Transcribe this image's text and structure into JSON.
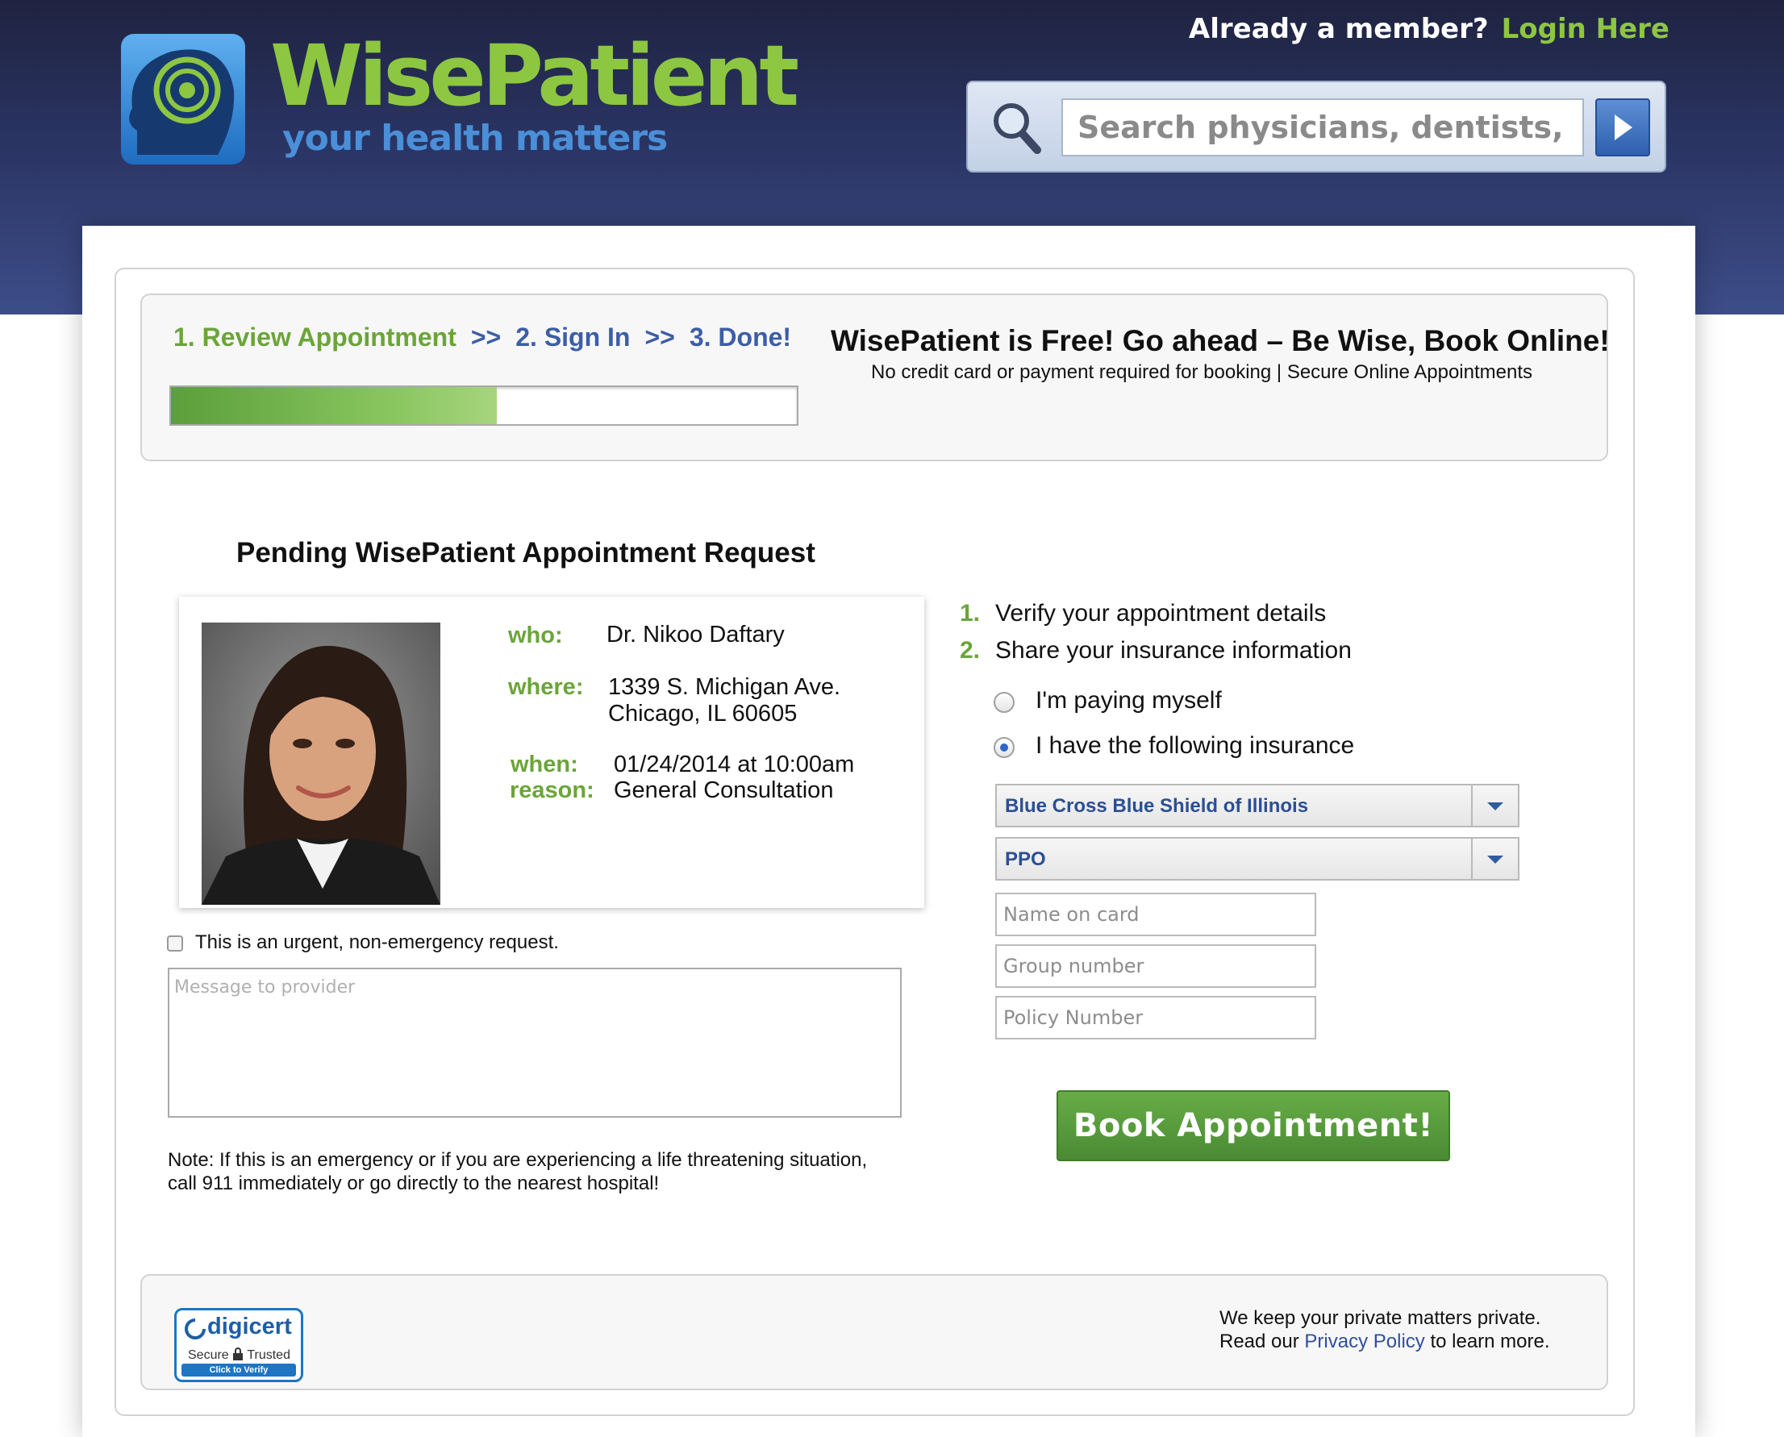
{
  "header": {
    "brand_name": "WisePatient",
    "tagline": "your health matters",
    "member_prompt": "Already a member?",
    "login_label": "Login Here",
    "search": {
      "placeholder": "Search physicians, dentists, etc"
    }
  },
  "progress": {
    "steps": [
      "1. Review Appointment",
      "2. Sign In",
      "3. Done!"
    ],
    "separator": ">>",
    "fraction_complete": 0.52,
    "colors": {
      "active": "#6aa539",
      "inactive": "#3c5ea8"
    }
  },
  "promo": {
    "title": "WisePatient is Free! Go ahead – Be Wise, Book Online!",
    "subtitle": "No credit card or payment required for booking | Secure Online Appointments"
  },
  "appointment": {
    "title": "Pending WisePatient Appointment Request",
    "who_label": "who:",
    "who": "Dr. Nikoo Daftary",
    "where_label": "where:",
    "address_line1": "1339 S. Michigan Ave.",
    "address_line2": "Chicago, IL 60605",
    "when_label": "when:",
    "when": "01/24/2014 at 10:00am",
    "reason_label": "reason:",
    "reason": "General Consultation",
    "urgent_label": "This is an urgent, non-emergency request.",
    "urgent_checked": false,
    "message_placeholder": "Message to provider",
    "note_line1": "Note: If this is an emergency or if you are experiencing a life threatening situation,",
    "note_line2": "call 911 immediately or go directly to the nearest hospital!"
  },
  "booking": {
    "instructions": [
      {
        "num": "1.",
        "text": "Verify your appointment details"
      },
      {
        "num": "2.",
        "text": "Share your insurance information"
      }
    ],
    "pay_self_label": "I'm paying myself",
    "insurance_label": "I have the following insurance",
    "selected_option": "insurance",
    "carrier": "Blue Cross Blue Shield of Illinois",
    "plan": "PPO",
    "name_placeholder": "Name on card",
    "group_placeholder": "Group number",
    "policy_placeholder": "Policy Number",
    "book_label": "Book Appointment!"
  },
  "footer": {
    "seal_brand": "digicert",
    "seal_secure": "Secure",
    "seal_trusted": "Trusted",
    "seal_verify": "Click to Verify",
    "privacy_line1": "We keep your private matters private.",
    "privacy_read": "Read our",
    "privacy_link": "Privacy Policy",
    "privacy_after": "to learn more."
  },
  "colors": {
    "brand_green": "#8dc641",
    "brand_blue": "#4a8fd8",
    "header_navy": "#2a3463",
    "button_green": "#5a9c3f"
  },
  "icons": [
    "head-swirl-logo-icon",
    "search-icon",
    "arrow-right-icon",
    "chevron-down-icon",
    "lock-icon"
  ]
}
